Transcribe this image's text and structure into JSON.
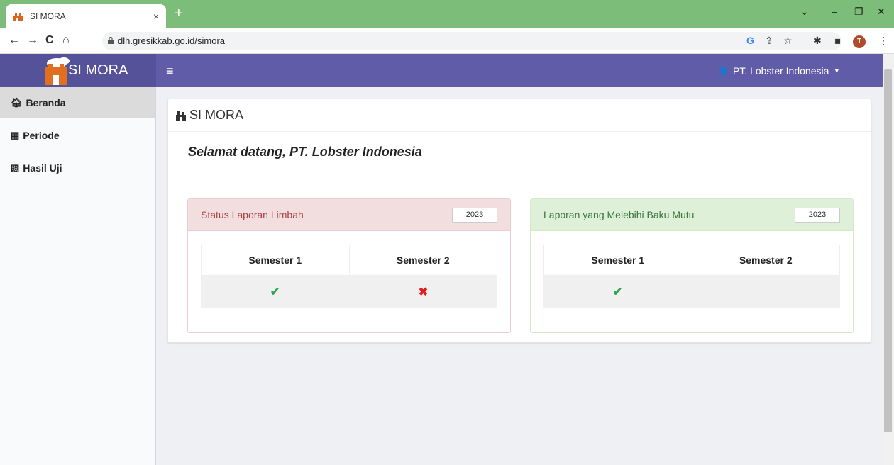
{
  "browser": {
    "tab_title": "SI MORA",
    "tab_close": "×",
    "new_tab": "+",
    "url": "dlh.gresikkab.go.id/simora",
    "profile_initial": "T"
  },
  "header": {
    "brand": "SI MORA",
    "menu_toggle": "≡",
    "user": "PT. Lobster Indonesia"
  },
  "sidebar": {
    "items": [
      {
        "label": "Beranda",
        "icon": "home-icon",
        "active": true
      },
      {
        "label": "Periode",
        "icon": "calendar-icon",
        "active": false
      },
      {
        "label": "Hasil Uji",
        "icon": "files-icon",
        "active": false
      }
    ]
  },
  "main": {
    "title": "SI MORA",
    "welcome": "Selamat datang, PT. Lobster Indonesia",
    "panels": [
      {
        "title": "Status Laporan Limbah",
        "year": "2023",
        "headers": [
          "Semester 1",
          "Semester 2"
        ],
        "status": [
          "✔",
          "✖"
        ],
        "status_meaning": [
          "done",
          "not done"
        ]
      },
      {
        "title": "Laporan yang Melebihi Baku Mutu",
        "year": "2023",
        "headers": [
          "Semester 1",
          "Semester 2"
        ],
        "status": [
          "✔",
          ""
        ],
        "status_meaning": [
          "done",
          "empty"
        ]
      }
    ]
  },
  "colors": {
    "appbar": "#605ca8",
    "tabbar": "#7cbd7a",
    "panel1_head": "#f2dede",
    "panel1_text": "#a94442",
    "panel2_head": "#dff0d8",
    "panel2_text": "#3c763d"
  }
}
